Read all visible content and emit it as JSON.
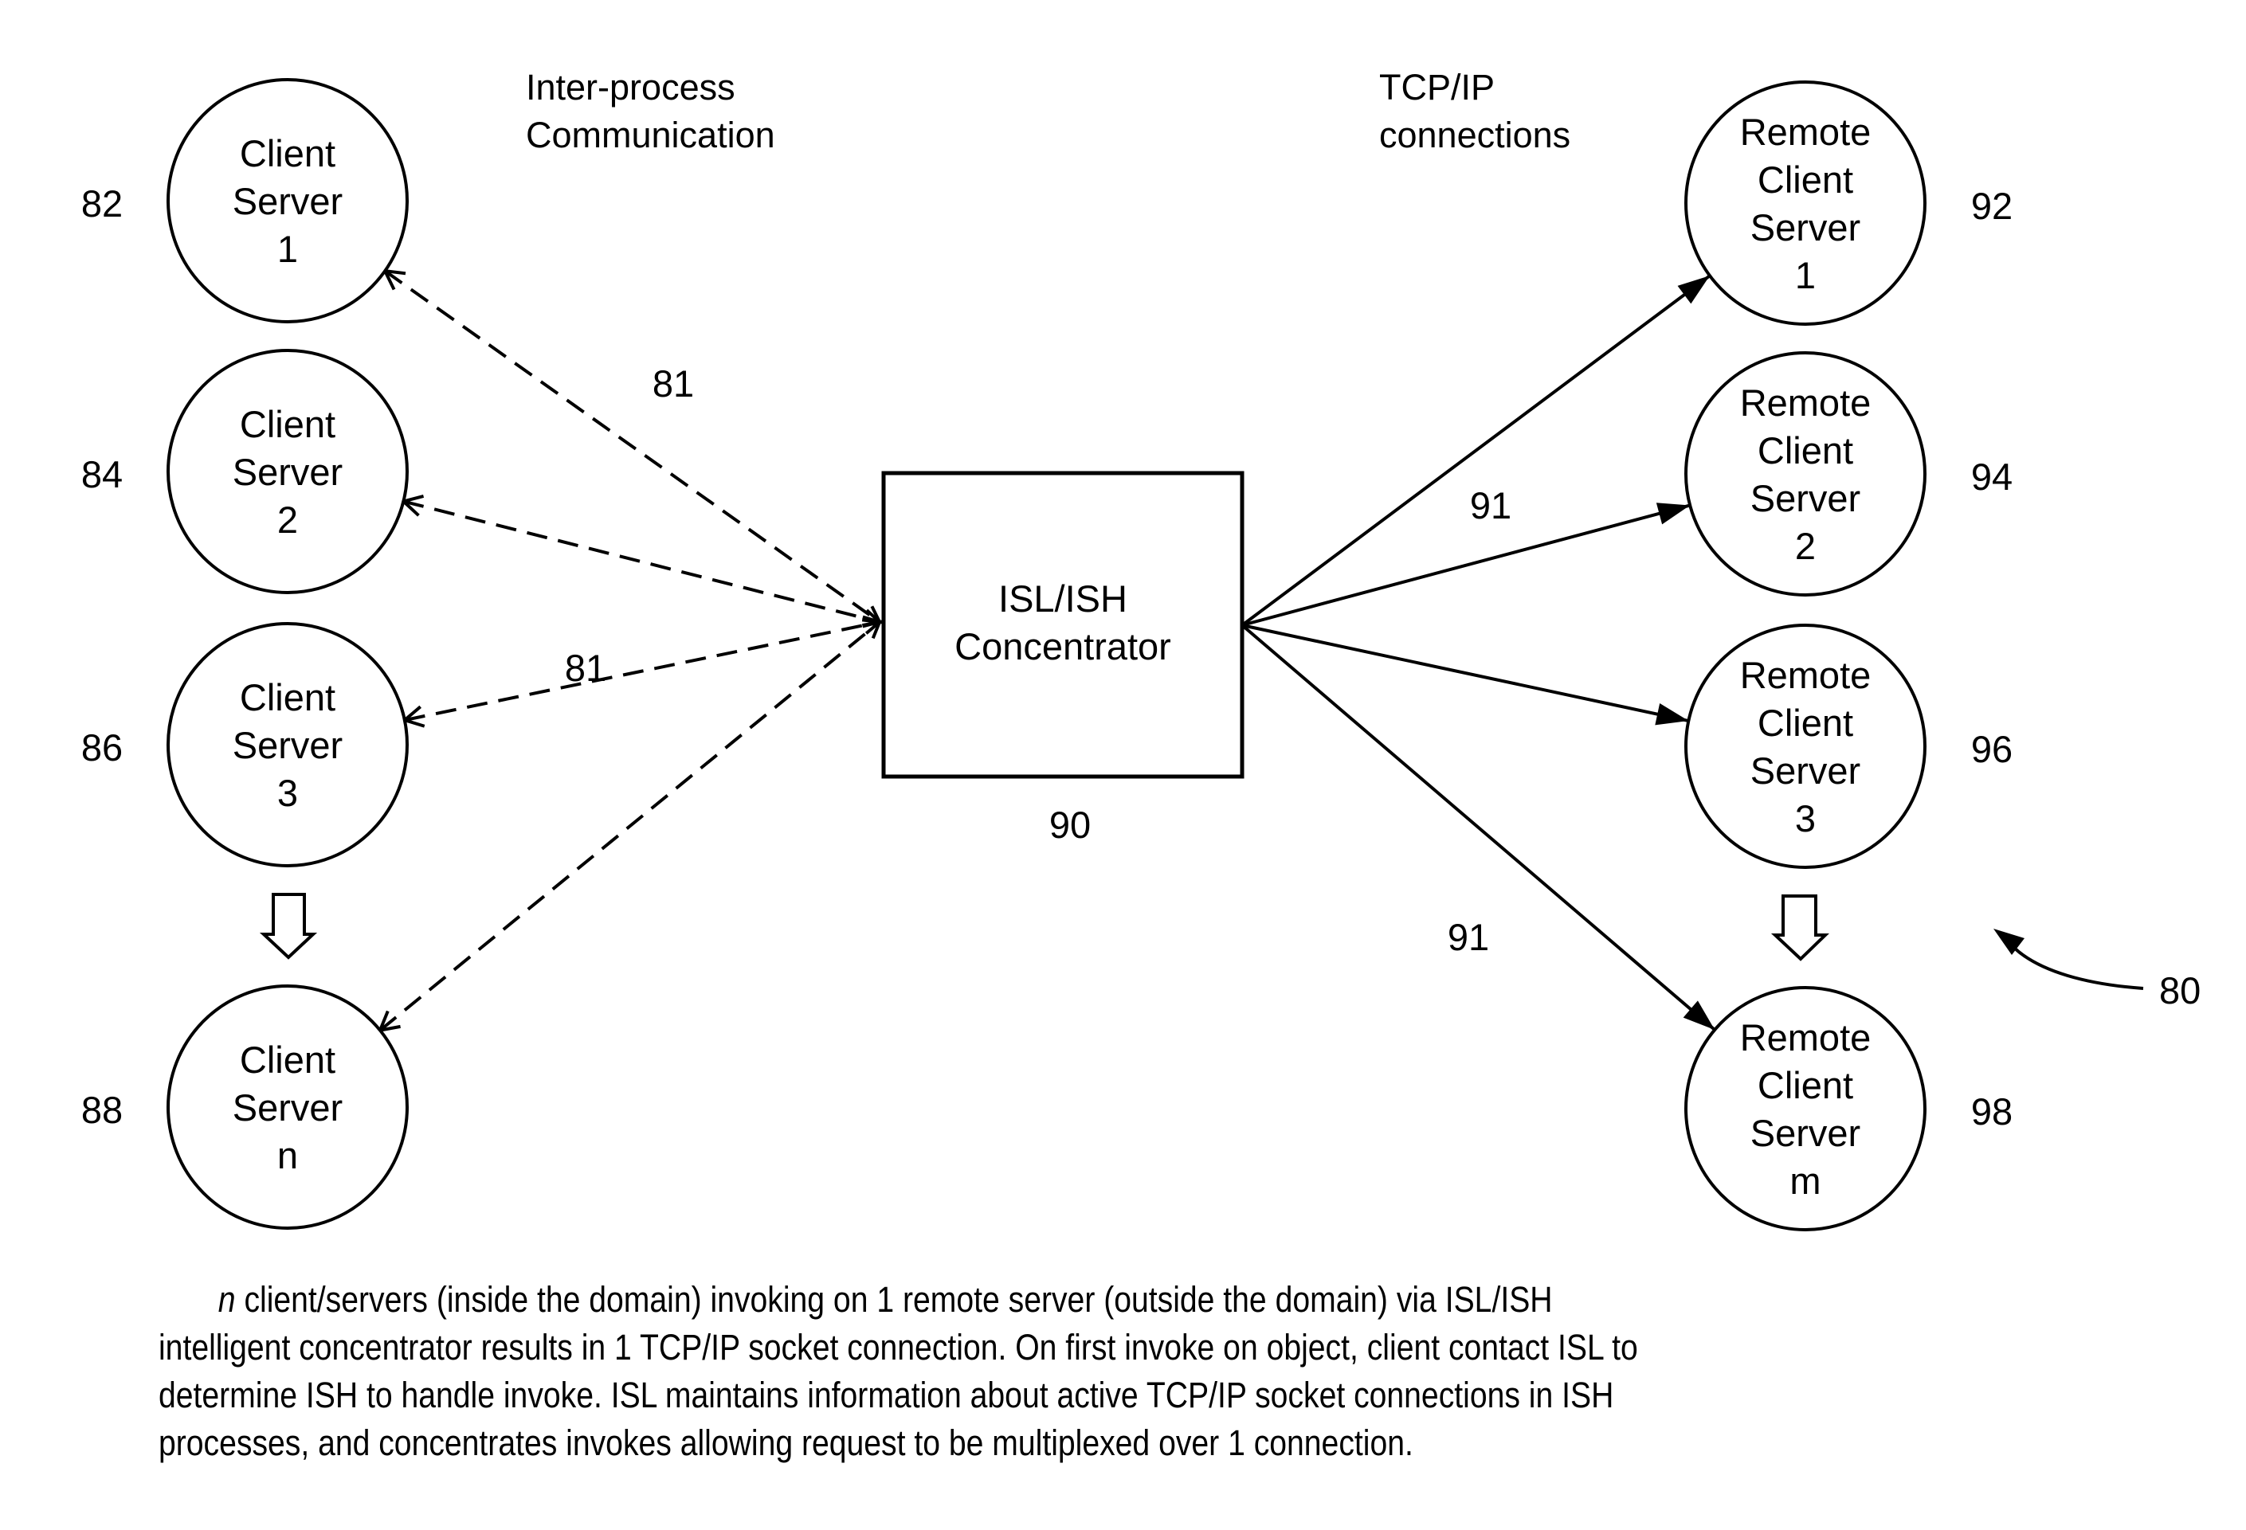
{
  "figure": {
    "figure_ref": "80",
    "colors": {
      "ink": "#000000",
      "paper": "#ffffff"
    }
  },
  "headings": {
    "ipc": [
      "Inter-process",
      "Communication"
    ],
    "tcp": [
      "TCP/IP",
      "connections"
    ]
  },
  "concentrator": {
    "lines": [
      "ISL/ISH",
      "Concentrator"
    ],
    "ref": "90"
  },
  "client_servers": [
    {
      "lines": [
        "Client",
        "Server",
        "1"
      ],
      "ref": "82"
    },
    {
      "lines": [
        "Client",
        "Server",
        "2"
      ],
      "ref": "84"
    },
    {
      "lines": [
        "Client",
        "Server",
        "3"
      ],
      "ref": "86"
    },
    {
      "lines": [
        "Client",
        "Server",
        "n"
      ],
      "ref": "88"
    }
  ],
  "remote_servers": [
    {
      "lines": [
        "Remote",
        "Client",
        "Server",
        "1"
      ],
      "ref": "92"
    },
    {
      "lines": [
        "Remote",
        "Client",
        "Server",
        "2"
      ],
      "ref": "94"
    },
    {
      "lines": [
        "Remote",
        "Client",
        "Server",
        "3"
      ],
      "ref": "96"
    },
    {
      "lines": [
        "Remote",
        "Client",
        "Server",
        "m"
      ],
      "ref": "98"
    }
  ],
  "link_labels": {
    "ipc": [
      "81",
      "81"
    ],
    "tcp": [
      "91",
      "91"
    ]
  },
  "continuation_icons": [
    "hollow-down-arrow-icon",
    "hollow-down-arrow-icon"
  ],
  "caption": {
    "emphasis": "n",
    "lines": [
      " client/servers (inside the domain) invoking on 1 remote server (outside the domain) via ISL/ISH",
      "intelligent concentrator results in 1 TCP/IP socket connection. On first invoke on object, client contact ISL to",
      "determine ISH to handle invoke. ISL maintains information about active TCP/IP socket connections in ISH",
      "processes, and concentrates invokes allowing request to be multiplexed over 1 connection."
    ]
  }
}
